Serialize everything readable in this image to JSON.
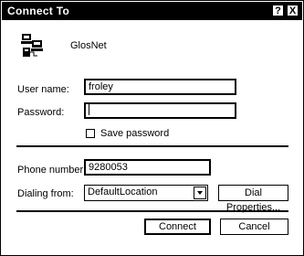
{
  "window": {
    "title": "Connect To",
    "help_label": "?",
    "close_label": "X"
  },
  "connection": {
    "name": "GlosNet"
  },
  "form": {
    "username_label": "User name:",
    "username_value": "froley",
    "password_label": "Password:",
    "password_value": "",
    "save_password_label": "Save password",
    "phone_label": "Phone number:",
    "phone_value": "9280053",
    "dialing_from_label": "Dialing from:",
    "dialing_from_value": "DefaultLocation"
  },
  "buttons": {
    "dial_properties": "Dial Properties...",
    "connect": "Connect",
    "cancel": "Cancel"
  }
}
